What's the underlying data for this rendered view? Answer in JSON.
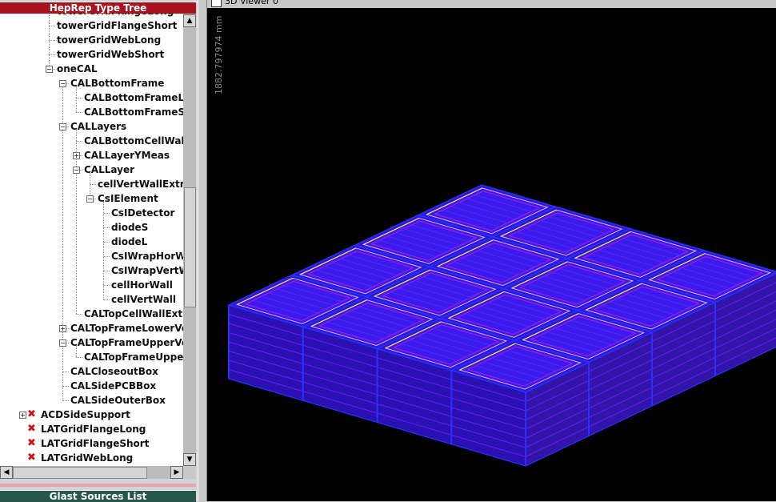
{
  "tree_panel": {
    "title": "HepRep Type Tree",
    "nodes": [
      {
        "label": "towerGridFlangeLong",
        "depth": 2,
        "expander": "none",
        "hidden": false
      },
      {
        "label": "towerGridFlangeShort",
        "depth": 2,
        "expander": "none",
        "hidden": false
      },
      {
        "label": "towerGridWebLong",
        "depth": 2,
        "expander": "none",
        "hidden": false
      },
      {
        "label": "towerGridWebShort",
        "depth": 2,
        "expander": "none",
        "hidden": false
      },
      {
        "label": "oneCAL",
        "depth": 2,
        "expander": "minus",
        "hidden": false
      },
      {
        "label": "CALBottomFrame",
        "depth": 3,
        "expander": "minus",
        "hidden": false
      },
      {
        "label": "CALBottomFrameLong",
        "depth": 4,
        "expander": "none",
        "hidden": false
      },
      {
        "label": "CALBottomFrameShort",
        "depth": 4,
        "expander": "none",
        "hidden": false
      },
      {
        "label": "CALLayers",
        "depth": 3,
        "expander": "minus",
        "hidden": false
      },
      {
        "label": "CALBottomCellWallExtra",
        "depth": 4,
        "expander": "none",
        "hidden": false
      },
      {
        "label": "CALLayerYMeas",
        "depth": 4,
        "expander": "plus",
        "hidden": false
      },
      {
        "label": "CALLayer",
        "depth": 4,
        "expander": "minus",
        "hidden": false
      },
      {
        "label": "cellVertWallExtra",
        "depth": 5,
        "expander": "none",
        "hidden": false
      },
      {
        "label": "CsIElement",
        "depth": 5,
        "expander": "minus",
        "hidden": false
      },
      {
        "label": "CsIDetector",
        "depth": 6,
        "expander": "none",
        "hidden": false
      },
      {
        "label": "diodeS",
        "depth": 6,
        "expander": "none",
        "hidden": false
      },
      {
        "label": "diodeL",
        "depth": 6,
        "expander": "none",
        "hidden": false
      },
      {
        "label": "CsIWrapHorWall",
        "depth": 6,
        "expander": "none",
        "hidden": false
      },
      {
        "label": "CsIWrapVertWall",
        "depth": 6,
        "expander": "none",
        "hidden": false
      },
      {
        "label": "cellHorWall",
        "depth": 6,
        "expander": "none",
        "hidden": false
      },
      {
        "label": "cellVertWall",
        "depth": 6,
        "expander": "none",
        "hidden": false
      },
      {
        "label": "CALTopCellWallExtra",
        "depth": 4,
        "expander": "none",
        "hidden": false
      },
      {
        "label": "CALTopFrameLowerVol",
        "depth": 3,
        "expander": "plus",
        "hidden": false
      },
      {
        "label": "CALTopFrameUpperVol",
        "depth": 3,
        "expander": "minus",
        "hidden": false
      },
      {
        "label": "CALTopFrameUpperC",
        "depth": 4,
        "expander": "none",
        "hidden": false
      },
      {
        "label": "CALCloseoutBox",
        "depth": 3,
        "expander": "none",
        "hidden": false
      },
      {
        "label": "CALSidePCBBox",
        "depth": 3,
        "expander": "none",
        "hidden": false
      },
      {
        "label": "CALSideOuterBox",
        "depth": 3,
        "expander": "none",
        "hidden": false
      },
      {
        "label": "ACDSideSupport",
        "depth": 0,
        "expander": "plus",
        "hidden": true
      },
      {
        "label": "LATGridFlangeLong",
        "depth": 0,
        "expander": "none",
        "hidden": true
      },
      {
        "label": "LATGridFlangeShort",
        "depth": 0,
        "expander": "none",
        "hidden": true
      },
      {
        "label": "LATGridWebLong",
        "depth": 0,
        "expander": "none",
        "hidden": true
      }
    ]
  },
  "sources_panel": {
    "title": "Glast Sources List"
  },
  "viewer": {
    "title": "3D Viewer 0",
    "scale_label": "1882.797974 mm",
    "grid": {
      "rows": 4,
      "cols": 4
    },
    "colors": {
      "background": "#000000",
      "frame": "#2a30ff",
      "layer": "#6a1cff",
      "wall": "#b21ee0",
      "highlight": "#e8a8ff",
      "accent_top": "#ffe060"
    }
  },
  "colors": {
    "tree_title_bg": "#a8131d",
    "sources_title_bg": "#27564d",
    "hidden_mark": "#c81414"
  }
}
